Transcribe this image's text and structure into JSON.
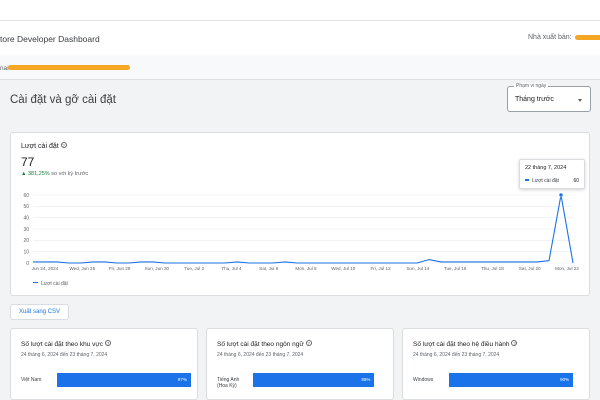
{
  "header": {
    "app_title": "tore Developer Dashboard",
    "publisher_label": "Nhà xuất bản:"
  },
  "subbar": {
    "label": "nai"
  },
  "page": {
    "title": "Cài đặt và gỡ cài đặt",
    "date_range": {
      "label": "Phạm vi ngày",
      "value": "Tháng trước"
    }
  },
  "installs": {
    "title": "Lượt cài đặt",
    "help": "?",
    "total": "77",
    "delta_pct": "381,25%",
    "delta_suffix": "so với kỳ trước",
    "tooltip": {
      "date": "22 tháng 7, 2024",
      "series": "Lượt cài đặt",
      "value": "60"
    },
    "legend": "Lượt cài đặt"
  },
  "chart_data": {
    "type": "line",
    "title": "Lượt cài đặt",
    "series": [
      {
        "name": "Lượt cài đặt",
        "color": "#1a73e8",
        "values": [
          1,
          1,
          1,
          0,
          0,
          1,
          1,
          0,
          0,
          1,
          1,
          0,
          0,
          0,
          0,
          0,
          0,
          1,
          0,
          0,
          0,
          1,
          0,
          0,
          0,
          0,
          0,
          0,
          0,
          0,
          0,
          0,
          0,
          3,
          1,
          1,
          1,
          1,
          1,
          1,
          1,
          1,
          1,
          2,
          60,
          0
        ]
      }
    ],
    "x_tick_labels": [
      "Jun 24, 2024",
      "Wed, Jun 26",
      "Fri, Jun 28",
      "Sun, Jun 30",
      "Tue, Jul 2",
      "Thu, Jul 4",
      "Sat, Jul 6",
      "Mon, Jul 8",
      "Wed, Jul 10",
      "Fri, Jul 12",
      "Sun, Jul 14",
      "Tue, Jul 16",
      "Thu, Jul 18",
      "Sat, Jul 20",
      "Mon, Jul 22"
    ],
    "y_ticks": [
      0,
      10,
      20,
      30,
      40,
      50,
      60
    ],
    "ylim": [
      0,
      60
    ],
    "highlight_point": {
      "index": 44,
      "value": 60
    },
    "grid": true,
    "legend": "bottom-left"
  },
  "actions": {
    "export_csv": "Xuất sang CSV"
  },
  "breakdown_cards": [
    {
      "title": "Số lượt cài đặt theo khu vực",
      "help": "?",
      "subtitle": "24 tháng 6, 2024 đến 23 tháng 7, 2024",
      "label": "Việt Nam",
      "pct_label": "97%",
      "pct": 0.97
    },
    {
      "title": "Số lượt cài đặt theo ngôn ngữ",
      "help": "?",
      "subtitle": "24 tháng 6, 2024 đến 23 tháng 7, 2024",
      "label": "Tiếng Anh (Hoa Kỳ)",
      "pct_label": "88%",
      "pct": 0.88
    },
    {
      "title": "Số lượt cài đặt theo hệ điều hành",
      "help": "?",
      "subtitle": "24 tháng 6, 2024 đến 23 tháng 7, 2024",
      "label": "Windows",
      "pct_label": "90%",
      "pct": 0.9
    }
  ]
}
